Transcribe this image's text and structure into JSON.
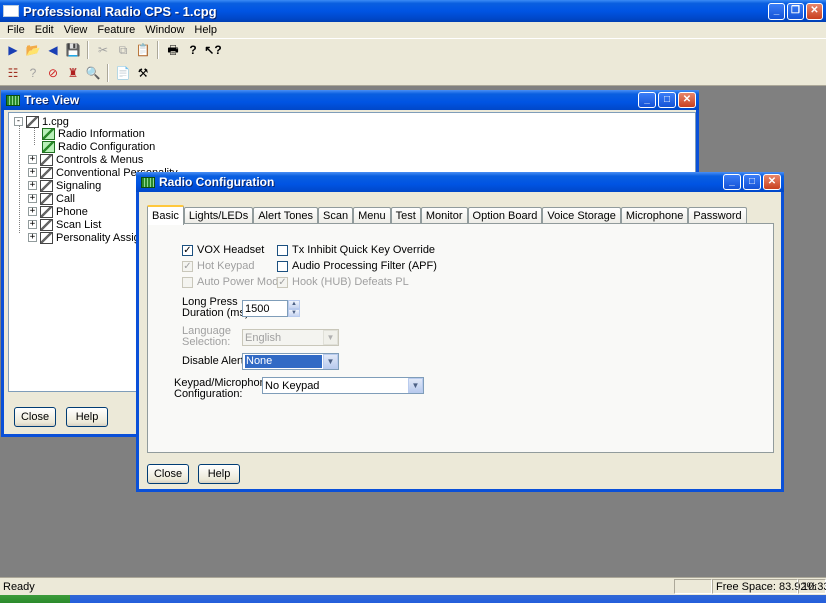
{
  "app": {
    "title": "Professional Radio CPS - 1.cpg",
    "menu": [
      "File",
      "Edit",
      "View",
      "Feature",
      "Window",
      "Help"
    ]
  },
  "toolbar1": [
    "read-radio-icon",
    "open-icon",
    "write-radio-icon",
    "save-icon",
    "cut-icon",
    "copy-icon",
    "paste-icon",
    "print-icon",
    "help-icon",
    "context-help-icon"
  ],
  "toolbar2": [
    "tree-icon",
    "disabled-icon",
    "stop-icon",
    "wizard-icon",
    "zoom-icon",
    "report-icon",
    "tools-icon"
  ],
  "tree_view": {
    "title": "Tree View",
    "root": "1.cpg",
    "items": [
      {
        "label": "Radio Information",
        "expandable": false
      },
      {
        "label": "Radio Configuration",
        "expandable": false
      },
      {
        "label": "Controls & Menus",
        "expandable": true
      },
      {
        "label": "Conventional Personality",
        "expandable": true
      },
      {
        "label": "Signaling",
        "expandable": true
      },
      {
        "label": "Call",
        "expandable": true
      },
      {
        "label": "Phone",
        "expandable": true
      },
      {
        "label": "Scan List",
        "expandable": true
      },
      {
        "label": "Personality Assignment",
        "expandable": true
      }
    ],
    "close_label": "Close",
    "help_label": "Help"
  },
  "radio_config": {
    "title": "Radio Configuration",
    "tabs": [
      "Basic",
      "Lights/LEDs",
      "Alert Tones",
      "Scan",
      "Menu",
      "Test",
      "Monitor",
      "Option Board",
      "Voice Storage",
      "Microphone",
      "Password"
    ],
    "active_tab": "Basic",
    "vox_headset": {
      "label": "VOX  Headset",
      "checked": true
    },
    "hot_keypad": {
      "label": "Hot Keypad",
      "checked": true
    },
    "auto_power_mode": {
      "label": "Auto Power Mode",
      "checked": false
    },
    "tx_inhibit": {
      "label": "Tx Inhibit Quick Key Override",
      "checked": false
    },
    "apf": {
      "label": "Audio Processing Filter (APF)",
      "checked": false
    },
    "hook_hub": {
      "label": "Hook (HUB) Defeats PL",
      "checked": true
    },
    "long_press": {
      "label_line1": "Long Press",
      "label_line2": "Duration (ms):",
      "value": "1500"
    },
    "language": {
      "label_line1": "Language",
      "label_line2": "Selection:",
      "value": "English"
    },
    "disable_alerts": {
      "label": "Disable Alerts:",
      "value": "None"
    },
    "keypad_mic": {
      "label_line1": "Keypad/Microphone",
      "label_line2": "Configuration:",
      "value": "No Keypad"
    },
    "close_label": "Close",
    "help_label": "Help"
  },
  "status": {
    "text": "Ready",
    "free_space": "Free Space: 83.92%",
    "time": "10:33"
  }
}
